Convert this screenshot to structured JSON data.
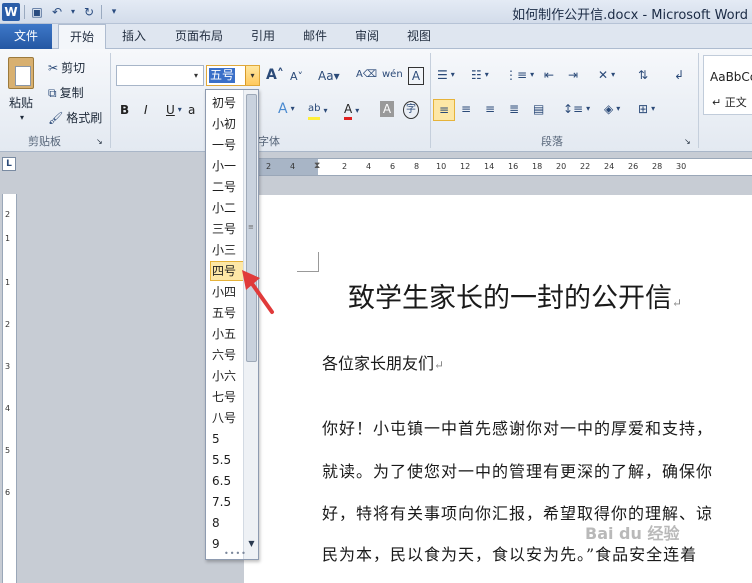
{
  "window": {
    "title": "如何制作公开信.docx - Microsoft Word"
  },
  "tabs": {
    "file": "文件",
    "items": [
      "开始",
      "插入",
      "页面布局",
      "引用",
      "邮件",
      "审阅",
      "视图"
    ]
  },
  "clipboard": {
    "paste": "粘贴",
    "cut": "剪切",
    "copy": "复制",
    "format_painter": "格式刷",
    "label": "剪贴板"
  },
  "font": {
    "name_value": "",
    "size_value": "五号",
    "label": "字体"
  },
  "paragraph": {
    "label": "段落"
  },
  "styles": {
    "preview": "AaBbCc",
    "name": "正文"
  },
  "font_size_options": [
    "初号",
    "小初",
    "一号",
    "小一",
    "二号",
    "小二",
    "三号",
    "小三",
    "四号",
    "小四",
    "五号",
    "小五",
    "六号",
    "小六",
    "七号",
    "八号",
    "5",
    "5.5",
    "6.5",
    "7.5",
    "8",
    "9"
  ],
  "font_size_hover": "四号",
  "ruler": {
    "h_ticks": [
      "2",
      "4",
      "2",
      "4",
      "6",
      "8",
      "10",
      "12",
      "14",
      "16",
      "18",
      "20",
      "22",
      "24",
      "26",
      "28",
      "30"
    ],
    "v_ticks": [
      "2",
      "1",
      "1",
      "2",
      "3",
      "4",
      "5",
      "6"
    ]
  },
  "document": {
    "title": "致学生家长的一封的公开信",
    "salutation": "各位家长朋友们",
    "paragraph_lines": [
      "你好！小屯镇一中首先感谢你对一中的厚爱和支持，",
      "就读。为了使您对一中的管理有更深的了解，确保你",
      "好，特将有关事项向你汇报，希望取得你的理解、谅",
      "民为本，民以食为天，食以安为先。”食品安全连着"
    ]
  },
  "watermark": "Bai du 经验",
  "colors": {
    "accent": "#2a5da8",
    "highlight": "#fde7a6",
    "annotation_arrow": "#e03a3a"
  }
}
